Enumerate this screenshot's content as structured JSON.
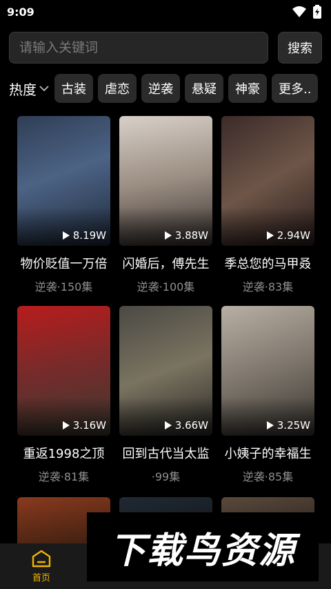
{
  "status_bar": {
    "time": "9:09"
  },
  "search": {
    "placeholder": "请输入关键词",
    "button_label": "搜索"
  },
  "filters": {
    "sort_label": "热度",
    "categories": [
      "古装",
      "虐恋",
      "逆袭",
      "悬疑",
      "神豪",
      "更多.."
    ]
  },
  "dramas": [
    {
      "title": "物价贬值一万倍",
      "meta": "逆袭·150集",
      "views": "8.19W"
    },
    {
      "title": "闪婚后，傅先生",
      "meta": "逆袭·100集",
      "views": "3.88W"
    },
    {
      "title": "季总您的马甲叒",
      "meta": "逆袭·83集",
      "views": "2.94W"
    },
    {
      "title": "重返1998之顶",
      "meta": "逆袭·81集",
      "views": "3.16W"
    },
    {
      "title": "回到古代当太监",
      "meta": "·99集",
      "views": "3.66W"
    },
    {
      "title": "小姨子的幸福生",
      "meta": "逆袭·85集",
      "views": "3.25W"
    }
  ],
  "bottom_nav": {
    "home_label": "首页"
  },
  "watermark": "下载鸟资源",
  "colors": {
    "accent": "#f3b500",
    "background": "#000000"
  }
}
